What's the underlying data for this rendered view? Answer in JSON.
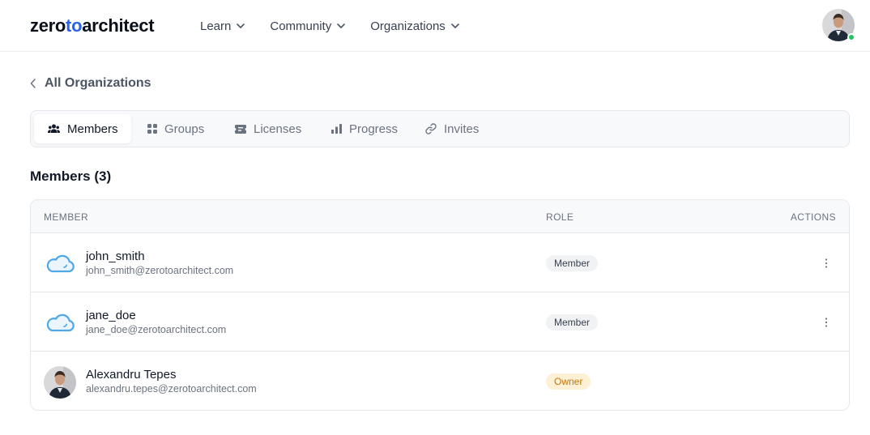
{
  "header": {
    "logo_part1": "zero",
    "logo_part2": "to",
    "logo_part3": "architect",
    "nav": [
      {
        "label": "Learn",
        "icon": "chevron-down-icon"
      },
      {
        "label": "Community",
        "icon": "chevron-down-icon"
      },
      {
        "label": "Organizations",
        "icon": "chevron-down-icon"
      }
    ],
    "status_color": "#22c55e"
  },
  "breadcrumb": {
    "back_label": "All Organizations"
  },
  "tabs": [
    {
      "label": "Members",
      "icon": "users-icon",
      "active": true
    },
    {
      "label": "Groups",
      "icon": "grid-icon",
      "active": false
    },
    {
      "label": "Licenses",
      "icon": "ticket-icon",
      "active": false
    },
    {
      "label": "Progress",
      "icon": "bar-chart-icon",
      "active": false
    },
    {
      "label": "Invites",
      "icon": "link-icon",
      "active": false
    }
  ],
  "members": {
    "title": "Members (3)",
    "columns": {
      "member": "MEMBER",
      "role": "ROLE",
      "actions": "ACTIONS"
    },
    "rows": [
      {
        "name": "john_smith",
        "email": "john_smith@zerotoarchitect.com",
        "role": "Member",
        "avatar": "cloud-icon"
      },
      {
        "name": "jane_doe",
        "email": "jane_doe@zerotoarchitect.com",
        "role": "Member",
        "avatar": "cloud-icon"
      },
      {
        "name": "Alexandru Tepes",
        "email": "alexandru.tepes@zerotoarchitect.com",
        "role": "Owner",
        "avatar": "photo"
      }
    ]
  },
  "colors": {
    "accent": "#2563eb",
    "owner_badge_bg": "#fdf0d4",
    "owner_badge_text": "#c2780c",
    "member_badge_bg": "#f1f2f4"
  }
}
